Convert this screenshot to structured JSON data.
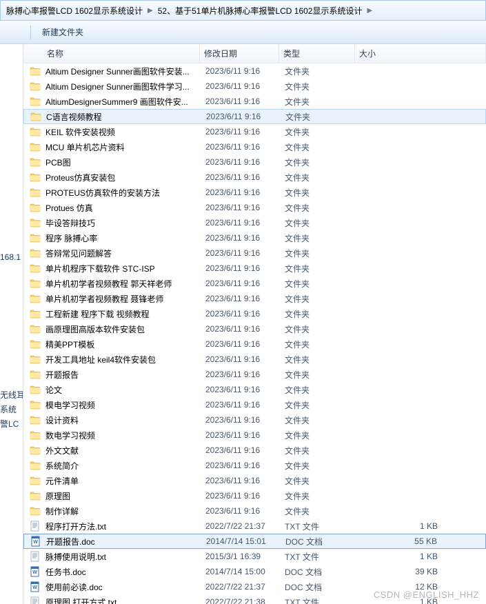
{
  "breadcrumb": {
    "crumb1": "脉搏心率报警LCD 1602显示系统设计",
    "crumb2": "52、基于51单片机脉搏心率报警LCD 1602显示系统设计"
  },
  "toolbar": {
    "new_folder": "新建文件夹"
  },
  "sidebar": {
    "item1": "168.1",
    "item2": "无线耳",
    "item3": "系统",
    "item4": "警LC"
  },
  "columns": {
    "name": "名称",
    "date": "修改日期",
    "type": "类型",
    "size": "大小"
  },
  "files": [
    {
      "icon": "folder",
      "name": "Altium Designer Sunner画图软件安装...",
      "date": "2023/6/11 9:16",
      "type": "文件夹",
      "size": ""
    },
    {
      "icon": "folder",
      "name": "Altium Designer Sunner画图软件学习...",
      "date": "2023/6/11 9:16",
      "type": "文件夹",
      "size": ""
    },
    {
      "icon": "folder",
      "name": "AltiumDesignerSummer9 画图软件安...",
      "date": "2023/6/11 9:16",
      "type": "文件夹",
      "size": ""
    },
    {
      "icon": "folder",
      "name": "C语言视频教程",
      "date": "2023/6/11 9:16",
      "type": "文件夹",
      "size": "",
      "state": "hovered"
    },
    {
      "icon": "folder",
      "name": "KEIL 软件安装视频",
      "date": "2023/6/11 9:16",
      "type": "文件夹",
      "size": ""
    },
    {
      "icon": "folder",
      "name": "MCU 单片机芯片资料",
      "date": "2023/6/11 9:16",
      "type": "文件夹",
      "size": ""
    },
    {
      "icon": "folder",
      "name": "PCB图",
      "date": "2023/6/11 9:16",
      "type": "文件夹",
      "size": ""
    },
    {
      "icon": "folder",
      "name": "Proteus仿真安装包",
      "date": "2023/6/11 9:16",
      "type": "文件夹",
      "size": ""
    },
    {
      "icon": "folder",
      "name": "PROTEUS仿真软件的安装方法",
      "date": "2023/6/11 9:16",
      "type": "文件夹",
      "size": ""
    },
    {
      "icon": "folder",
      "name": "Protues 仿真",
      "date": "2023/6/11 9:16",
      "type": "文件夹",
      "size": ""
    },
    {
      "icon": "folder",
      "name": "毕设答辩技巧",
      "date": "2023/6/11 9:16",
      "type": "文件夹",
      "size": ""
    },
    {
      "icon": "folder",
      "name": "程序 脉搏心率",
      "date": "2023/6/11 9:16",
      "type": "文件夹",
      "size": ""
    },
    {
      "icon": "folder",
      "name": "答辩常见问题解答",
      "date": "2023/6/11 9:16",
      "type": "文件夹",
      "size": ""
    },
    {
      "icon": "folder",
      "name": "单片机程序下载软件 STC-ISP",
      "date": "2023/6/11 9:16",
      "type": "文件夹",
      "size": ""
    },
    {
      "icon": "folder",
      "name": "单片机初学者视频教程 郭天祥老师",
      "date": "2023/6/11 9:16",
      "type": "文件夹",
      "size": ""
    },
    {
      "icon": "folder",
      "name": "单片机初学者视频教程 聂锋老师",
      "date": "2023/6/11 9:16",
      "type": "文件夹",
      "size": ""
    },
    {
      "icon": "folder",
      "name": "工程新建 程序下载 视频教程",
      "date": "2023/6/11 9:16",
      "type": "文件夹",
      "size": ""
    },
    {
      "icon": "folder",
      "name": "画原理图高版本软件安装包",
      "date": "2023/6/11 9:16",
      "type": "文件夹",
      "size": ""
    },
    {
      "icon": "folder",
      "name": "精美PPT模板",
      "date": "2023/6/11 9:16",
      "type": "文件夹",
      "size": ""
    },
    {
      "icon": "folder",
      "name": "开发工具地址 keil4软件安装包",
      "date": "2023/6/11 9:16",
      "type": "文件夹",
      "size": ""
    },
    {
      "icon": "folder",
      "name": "开题报告",
      "date": "2023/6/11 9:16",
      "type": "文件夹",
      "size": ""
    },
    {
      "icon": "folder",
      "name": "论文",
      "date": "2023/6/11 9:16",
      "type": "文件夹",
      "size": ""
    },
    {
      "icon": "folder",
      "name": "模电学习视频",
      "date": "2023/6/11 9:16",
      "type": "文件夹",
      "size": ""
    },
    {
      "icon": "folder",
      "name": "设计资料",
      "date": "2023/6/11 9:16",
      "type": "文件夹",
      "size": ""
    },
    {
      "icon": "folder",
      "name": "数电学习视频",
      "date": "2023/6/11 9:16",
      "type": "文件夹",
      "size": ""
    },
    {
      "icon": "folder",
      "name": "外文文献",
      "date": "2023/6/11 9:16",
      "type": "文件夹",
      "size": ""
    },
    {
      "icon": "folder",
      "name": "系统简介",
      "date": "2023/6/11 9:16",
      "type": "文件夹",
      "size": ""
    },
    {
      "icon": "folder",
      "name": "元件清单",
      "date": "2023/6/11 9:16",
      "type": "文件夹",
      "size": ""
    },
    {
      "icon": "folder",
      "name": "原理图",
      "date": "2023/6/11 9:16",
      "type": "文件夹",
      "size": ""
    },
    {
      "icon": "folder",
      "name": "制作详解",
      "date": "2023/6/11 9:16",
      "type": "文件夹",
      "size": ""
    },
    {
      "icon": "txt",
      "name": "程序打开方法.txt",
      "date": "2022/7/22 21:37",
      "type": "TXT 文件",
      "size": "1 KB"
    },
    {
      "icon": "doc",
      "name": "开题报告.doc",
      "date": "2014/7/14 15:01",
      "type": "DOC 文档",
      "size": "55 KB",
      "state": "selected"
    },
    {
      "icon": "txt",
      "name": "脉搏使用说明.txt",
      "date": "2015/3/1 16:39",
      "type": "TXT 文件",
      "size": "1 KB"
    },
    {
      "icon": "doc",
      "name": "任务书.doc",
      "date": "2014/7/14 15:00",
      "type": "DOC 文档",
      "size": "39 KB"
    },
    {
      "icon": "doc",
      "name": "使用前必读.doc",
      "date": "2022/7/22 21:37",
      "type": "DOC 文档",
      "size": "12 KB"
    },
    {
      "icon": "txt",
      "name": "原理图 打开方式.txt",
      "date": "2022/7/22 21:38",
      "type": "TXT 文件",
      "size": "1 KB"
    }
  ],
  "watermark": "CSDN @ENGLISH_HHZ"
}
